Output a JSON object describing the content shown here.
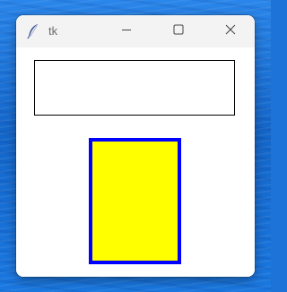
{
  "window": {
    "title": "tk",
    "app_icon": "tk-feather-icon"
  },
  "titlebar_buttons": {
    "minimize_icon": "minimize-icon",
    "maximize_icon": "maximize-icon",
    "close_icon": "close-icon"
  },
  "entry": {
    "value": "",
    "placeholder": ""
  },
  "colors": {
    "rect_fill": "#ffff00",
    "rect_outline": "#0000ff",
    "desktop": "#1e73d8"
  }
}
